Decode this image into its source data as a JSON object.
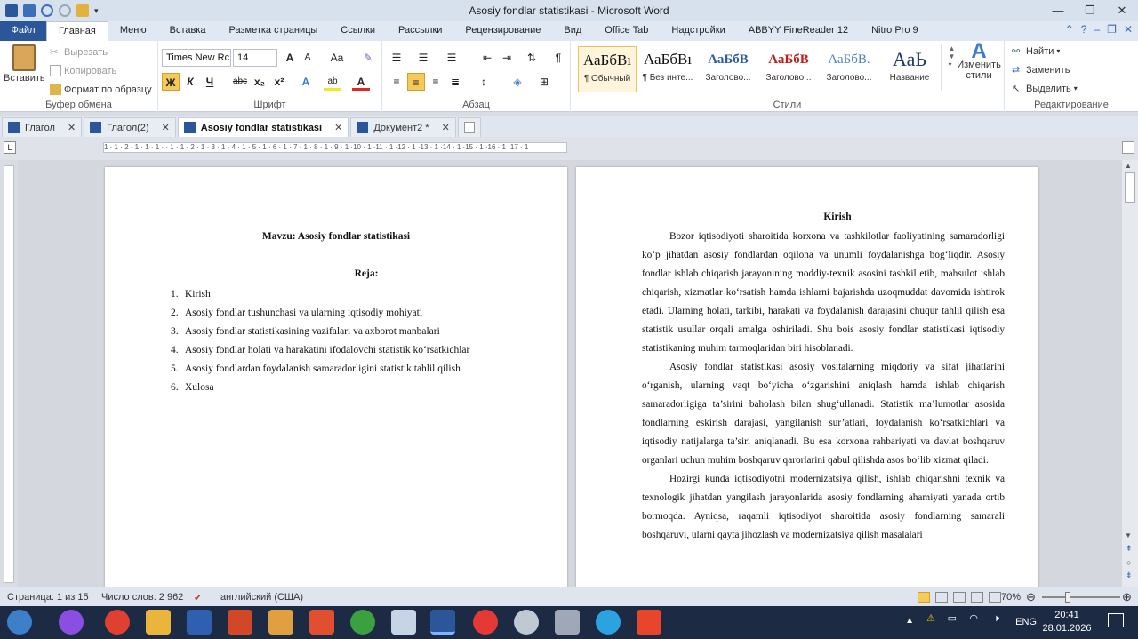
{
  "window": {
    "title": "Asosiy fondlar statistikasi  -  Microsoft Word"
  },
  "ribbon_tabs": [
    "Файл",
    "Главная",
    "Меню",
    "Вставка",
    "Разметка страницы",
    "Ссылки",
    "Рассылки",
    "Рецензирование",
    "Вид",
    "Office Tab",
    "Надстройки",
    "ABBYY FineReader 12",
    "Nitro Pro 9"
  ],
  "clipboard": {
    "paste": "Вставить",
    "cut": "Вырезать",
    "copy": "Копировать",
    "format_painter": "Формат по образцу",
    "label": "Буфер обмена"
  },
  "font": {
    "name": "Times New Rc",
    "size": "14",
    "label": "Шрифт",
    "bold": "Ж",
    "italic": "К",
    "underline": "Ч",
    "strike": "abc",
    "sub": "x₂",
    "sup": "x²",
    "grow": "A",
    "shrink": "A",
    "case": "Aa",
    "text_effects": "A",
    "highlight": "ab",
    "font_color": "A"
  },
  "paragraph": {
    "label": "Абзац",
    "show_marks": "¶"
  },
  "styles": {
    "label": "Стили",
    "cards": [
      {
        "preview": "АаБбВı",
        "name": "¶ Обычный"
      },
      {
        "preview": "АаБбВı",
        "name": "¶ Без инте..."
      },
      {
        "preview": "АаБбВ",
        "name": "Заголово..."
      },
      {
        "preview": "АаБбВ",
        "name": "Заголово..."
      },
      {
        "preview": "АаБбВ.",
        "name": "Заголово..."
      },
      {
        "preview": "АаЬ",
        "name": "Название"
      }
    ],
    "change": "Изменить стили"
  },
  "editing": {
    "find": "Найти",
    "replace": "Заменить",
    "select": "Выделить",
    "label": "Редактирование"
  },
  "doc_tabs": [
    {
      "label": "Глагол"
    },
    {
      "label": "Глагол(2)"
    },
    {
      "label": "Asosiy fondlar statistikasi"
    },
    {
      "label": "Документ2 *"
    }
  ],
  "ruler_text": "1 · 1 · 2 · 1 · 1 · 1 · ·  1 · 1 · 2 · 1 · 3 · 1 · 4 · 1 · 5 · 1 · 6 · 1 · 7 · 1 · 8 · 1 · 9 · 1 ·10 · 1 ·11 · 1 ·12 · 1 ·13 · 1 ·14 · 1 ·15 · 1 ·16 · 1 ·17 · 1",
  "page1": {
    "title": "Mavzu: Asosiy fondlar statistikasi",
    "plan": "Reja:",
    "items": [
      {
        "n": "1.",
        "text": "Kirish"
      },
      {
        "n": "2.",
        "text": "Asosiy fondlar tushunchasi va ularning iqtisodiy mohiyati"
      },
      {
        "n": "3.",
        "text": "Asosiy fondlar statistikasining vazifalari va axborot manbalari"
      },
      {
        "n": "4.",
        "text": "Asosiy fondlar holati va harakatini ifodalovchi statistik ko‘rsatkichlar"
      },
      {
        "n": "5.",
        "text": "Asosiy fondlardan foydalanish samaradorligini statistik tahlil qilish"
      },
      {
        "n": "6.",
        "text": "Xulosa"
      }
    ]
  },
  "page2": {
    "heading": "Kirish",
    "paragraphs": [
      "Bozor iqtisodiyoti sharoitida korxona va tashkilotlar faoliyatining samaradorligi ko‘p jihatdan asosiy fondlardan oqilona va unumli foydalanishga bog‘liqdir. Asosiy fondlar ishlab chiqarish jarayonining moddiy-texnik asosini tashkil etib, mahsulot ishlab chiqarish, xizmatlar ko‘rsatish hamda ishlarni bajarishda uzoqmuddat davomida ishtirok etadi. Ularning holati, tarkibi, harakati va foydalanish darajasini chuqur tahlil qilish esa statistik usullar orqali amalga oshiriladi. Shu bois asosiy fondlar statistikasi iqtisodiy statistikaning muhim tarmoqlaridan biri hisoblanadi.",
      "Asosiy fondlar statistikasi asosiy vositalarning miqdoriy va sifat jihatlarini o‘rganish, ularning vaqt bo‘yicha o‘zgarishini aniqlash hamda ishlab chiqarish samaradorligiga ta’sirini baholash bilan shug‘ullanadi. Statistik ma’lumotlar asosida fondlarning eskirish darajasi, yangilanish sur’atlari, foydalanish ko‘rsatkichlari va iqtisodiy natijalarga ta’siri aniqlanadi. Bu esa korxona rahbariyati va davlat boshqaruv organlari uchun muhim boshqaruv qarorlarini qabul qilishda asos bo‘lib xizmat qiladi.",
      "Hozirgi kunda iqtisodiyotni modernizatsiya qilish, ishlab chiqarishni texnik va texnologik jihatdan yangilash jarayonlarida asosiy fondlarning ahamiyati yanada ortib bormoqda. Ayniqsa, raqamli iqtisodiyot sharoitida asosiy fondlarning samarali boshqaruvi, ularni qayta jihozlash va modernizatsiya qilish masalalari"
    ]
  },
  "status": {
    "page": "Страница: 1 из 15",
    "words": "Число слов: 2 962",
    "lang": "английский (США)",
    "zoom": "70%",
    "zoom_level": 0.7
  },
  "taskbar": {
    "lang": "ENG",
    "time": "20:41",
    "date": "28.01.2026"
  }
}
